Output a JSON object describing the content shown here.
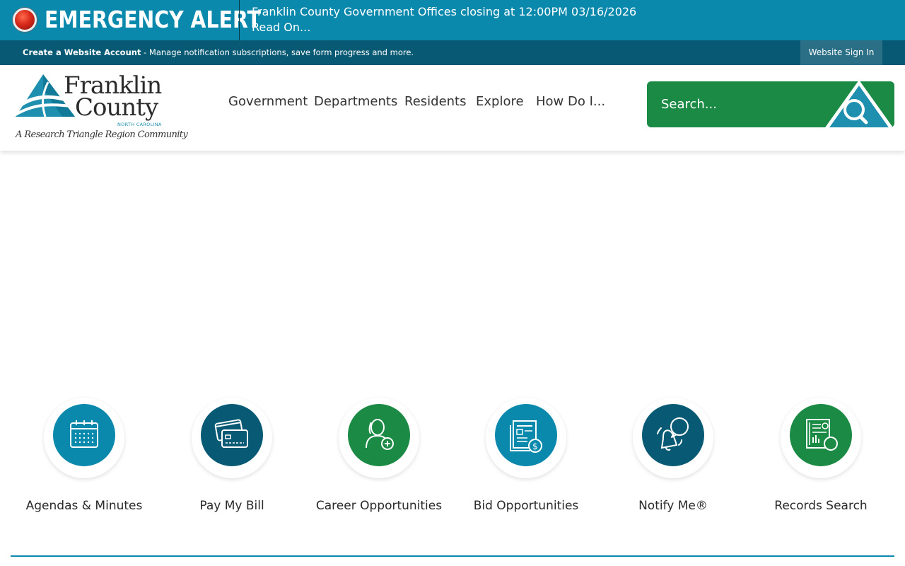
{
  "alert": {
    "title": "EMERGENCY ALERT",
    "message": "Franklin County Government Offices closing at 12:00PM 03/16/2026",
    "link": "Read On..."
  },
  "account_bar": {
    "create_account": "Create a Website Account",
    "description": " - Manage notification subscriptions, save form progress and more.",
    "sign_in": "Website Sign In"
  },
  "logo": {
    "line1": "Franklin",
    "line2": "County",
    "state": "NORTH CAROLINA",
    "tagline": "A Research Triangle Region Community"
  },
  "nav": {
    "items": [
      "Government",
      "Departments",
      "Residents",
      "Explore",
      "How Do I..."
    ]
  },
  "search": {
    "placeholder": "Search...",
    "icon": "search-icon"
  },
  "quick_links": [
    {
      "label": "Agendas & Minutes",
      "icon": "calendar-icon",
      "color": "#0a89ad"
    },
    {
      "label": "Pay My Bill",
      "icon": "credit-card-icon",
      "color": "#085a74"
    },
    {
      "label": "Career Opportunities",
      "icon": "add-person-icon",
      "color": "#1b8a45"
    },
    {
      "label": "Bid Opportunities",
      "icon": "bid-document-icon",
      "color": "#0a89ad"
    },
    {
      "label": "Notify Me®",
      "icon": "notification-bell-icon",
      "color": "#085a74"
    },
    {
      "label": "Records Search",
      "icon": "records-document-icon",
      "color": "#1b8a45"
    }
  ],
  "colors": {
    "alert_bar": "#0a89ad",
    "account_bar": "#085a74",
    "green": "#1b8a45",
    "dark_teal": "#085a74"
  }
}
